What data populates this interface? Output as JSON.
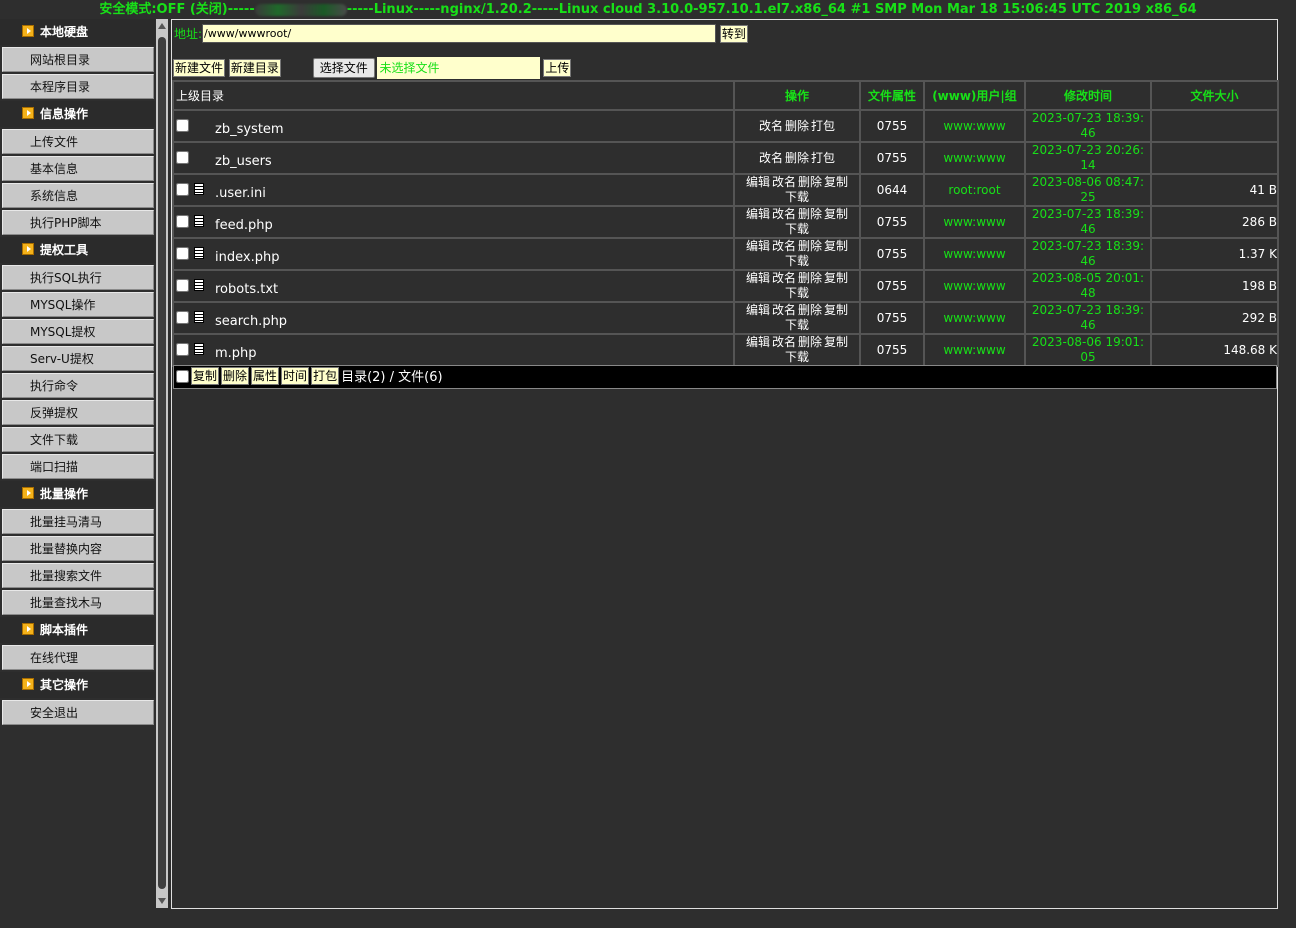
{
  "topbar": {
    "prefix": "安全模式:OFF (关闭)-----",
    "suffix": "-----Linux-----nginx/1.20.2-----Linux cloud 3.10.0-957.10.1.el7.x86_64 #1 SMP Mon Mar 18 15:06:45 UTC 2019 x86_64"
  },
  "sidebar": {
    "sections": [
      {
        "title": "本地硬盘",
        "items": [
          "网站根目录",
          "本程序目录"
        ]
      },
      {
        "title": "信息操作",
        "items": [
          "上传文件",
          "基本信息",
          "系统信息",
          "执行PHP脚本"
        ]
      },
      {
        "title": "提权工具",
        "items": [
          "执行SQL执行",
          "MYSQL操作",
          "MYSQL提权",
          "Serv-U提权",
          "执行命令",
          "反弹提权",
          "文件下载",
          "端口扫描"
        ]
      },
      {
        "title": "批量操作",
        "items": [
          "批量挂马清马",
          "批量替换内容",
          "批量搜索文件",
          "批量查找木马"
        ]
      },
      {
        "title": "脚本插件",
        "items": [
          "在线代理"
        ]
      },
      {
        "title": "其它操作",
        "items": [
          "安全退出"
        ]
      }
    ]
  },
  "address": {
    "label": "地址:",
    "value": "/www/wwwroot/",
    "go": "转到"
  },
  "toolbar": {
    "new_file": "新建文件",
    "new_dir": "新建目录",
    "choose_file": "选择文件",
    "no_file": "未选择文件",
    "upload": "上传"
  },
  "table": {
    "headers": {
      "parent": "上级目录",
      "ops": "操作",
      "perm": "文件属性",
      "owner": "(www)用户|组",
      "mtime": "修改时间",
      "size": "文件大小"
    },
    "rows": [
      {
        "name": "zb_system",
        "is_dir": true,
        "ops": [
          "改名",
          "删除",
          "打包"
        ],
        "perm": "0755",
        "owner": "www:www",
        "mtime": [
          "2023-07-23 18:39:",
          "46"
        ],
        "size": ""
      },
      {
        "name": "zb_users",
        "is_dir": true,
        "ops": [
          "改名",
          "删除",
          "打包"
        ],
        "perm": "0755",
        "owner": "www:www",
        "mtime": [
          "2023-07-23 20:26:",
          "14"
        ],
        "size": ""
      },
      {
        "name": ".user.ini",
        "is_dir": false,
        "ops": [
          "编辑",
          "改名",
          "删除",
          "复制",
          "下载"
        ],
        "perm": "0644",
        "owner": "root:root",
        "mtime": [
          "2023-08-06 08:47:",
          "25"
        ],
        "size": "41 B"
      },
      {
        "name": "feed.php",
        "is_dir": false,
        "ops": [
          "编辑",
          "改名",
          "删除",
          "复制",
          "下载"
        ],
        "perm": "0755",
        "owner": "www:www",
        "mtime": [
          "2023-07-23 18:39:",
          "46"
        ],
        "size": "286 B"
      },
      {
        "name": "index.php",
        "is_dir": false,
        "ops": [
          "编辑",
          "改名",
          "删除",
          "复制",
          "下载"
        ],
        "perm": "0755",
        "owner": "www:www",
        "mtime": [
          "2023-07-23 18:39:",
          "46"
        ],
        "size": "1.37 K"
      },
      {
        "name": "robots.txt",
        "is_dir": false,
        "ops": [
          "编辑",
          "改名",
          "删除",
          "复制",
          "下载"
        ],
        "perm": "0755",
        "owner": "www:www",
        "mtime": [
          "2023-08-05 20:01:",
          "48"
        ],
        "size": "198 B"
      },
      {
        "name": "search.php",
        "is_dir": false,
        "ops": [
          "编辑",
          "改名",
          "删除",
          "复制",
          "下载"
        ],
        "perm": "0755",
        "owner": "www:www",
        "mtime": [
          "2023-07-23 18:39:",
          "46"
        ],
        "size": "292 B"
      },
      {
        "name": "m.php",
        "is_dir": false,
        "ops": [
          "编辑",
          "改名",
          "删除",
          "复制",
          "下载"
        ],
        "perm": "0755",
        "owner": "www:www",
        "mtime": [
          "2023-08-06 19:01:",
          "05"
        ],
        "size": "148.68 K"
      }
    ]
  },
  "bottom": {
    "buttons": [
      "复制",
      "删除",
      "属性",
      "时间",
      "打包"
    ],
    "summary": "目录(2) / 文件(6)"
  },
  "colors": {
    "accent_green": "#18e018",
    "button_bg": "#ffffcc",
    "background": "#2e2e2e"
  }
}
